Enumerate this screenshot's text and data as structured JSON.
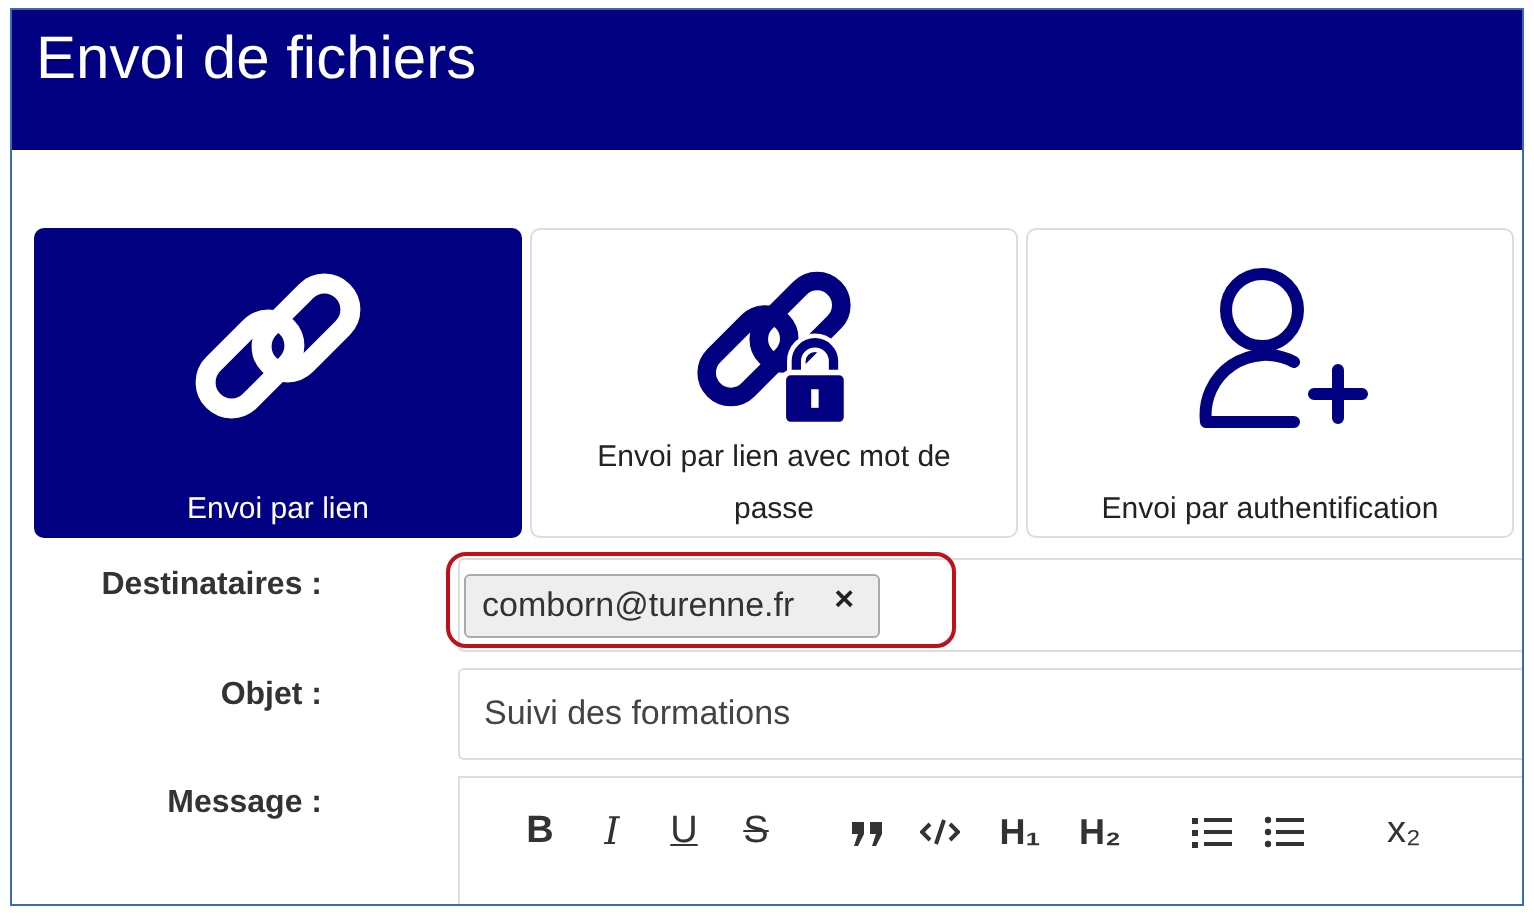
{
  "header": {
    "title": "Envoi de fichiers"
  },
  "modes": [
    {
      "kind": "link",
      "label": "Envoi par lien",
      "selected": true
    },
    {
      "kind": "link-lock",
      "label": "Envoi par lien avec mot de passe",
      "selected": false
    },
    {
      "kind": "user-add",
      "label": "Envoi par authentification",
      "selected": false
    }
  ],
  "form": {
    "recipients": {
      "label": "Destinataires :",
      "tags": [
        {
          "text": "comborn@turenne.fr",
          "remove": "×"
        }
      ],
      "highlighted": true
    },
    "subject": {
      "label": "Objet :",
      "value": "Suivi des formations"
    },
    "message": {
      "label": "Message :",
      "toolbar": [
        {
          "kind": "bold",
          "label": "B"
        },
        {
          "kind": "italic",
          "label": "I"
        },
        {
          "kind": "underline",
          "label": "U"
        },
        {
          "kind": "strike",
          "label": "S"
        },
        {
          "kind": "quote"
        },
        {
          "kind": "code"
        },
        {
          "kind": "heading",
          "label": "H₁"
        },
        {
          "kind": "heading",
          "label": "H₂"
        },
        {
          "kind": "ordered-list"
        },
        {
          "kind": "bullet-list"
        },
        {
          "kind": "subscript",
          "label": "x₂"
        }
      ]
    }
  }
}
